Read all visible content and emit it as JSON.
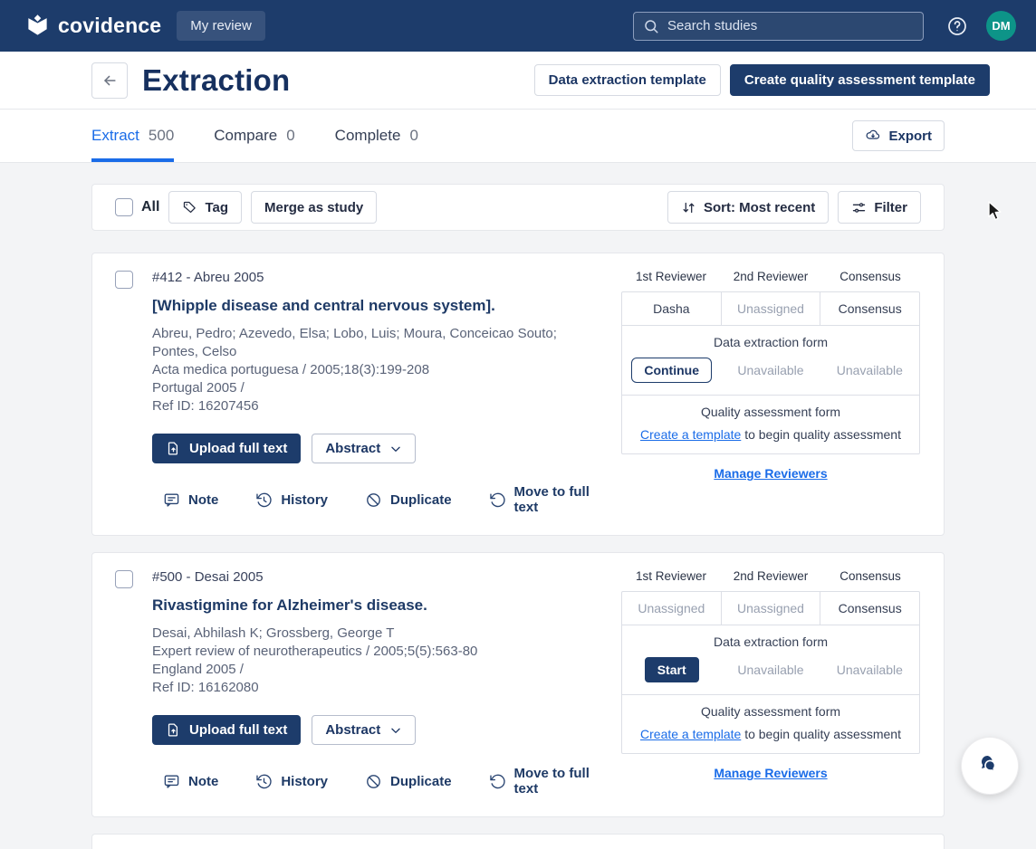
{
  "colors": {
    "header_bg": "#1d3c6b",
    "brand_navy": "#1d3c6b",
    "accent_blue": "#1a6ce8",
    "avatar_teal": "#0d9488",
    "page_bg": "#f3f4f6",
    "border": "#e5e7eb"
  },
  "header": {
    "brand": "covidence",
    "my_review": "My review",
    "search_placeholder": "Search studies",
    "avatar": "DM"
  },
  "title_bar": {
    "title": "Extraction",
    "secondary_button": "Data extraction template",
    "primary_button": "Create quality assessment template"
  },
  "tabs": [
    {
      "label": "Extract",
      "count": "500"
    },
    {
      "label": "Compare",
      "count": "0"
    },
    {
      "label": "Complete",
      "count": "0"
    }
  ],
  "export_button": "Export",
  "toolbar": {
    "all": "All",
    "tag": "Tag",
    "merge": "Merge as study",
    "sort": "Sort: Most recent",
    "filter": "Filter"
  },
  "reviewer_table": {
    "headers": [
      "1st Reviewer",
      "2nd Reviewer",
      "Consensus"
    ],
    "extraction_title": "Data extraction form",
    "quality_title": "Quality assessment form",
    "quality_link": "Create a template",
    "quality_rest": " to begin quality assessment",
    "manage": "Manage Reviewers"
  },
  "studies": [
    {
      "ref": "#412 - Abreu 2005",
      "title": "[Whipple disease and central nervous system].",
      "authors": "Abreu, Pedro; Azevedo, Elsa; Lobo, Luis; Moura, Conceicao Souto; Pontes, Celso",
      "source": "Acta medica portuguesa / 2005;18(3):199-208",
      "location": "Portugal 2005 /",
      "ref_id": "Ref ID: 16207456",
      "upload": "Upload full text",
      "abstract": "Abstract",
      "actions": [
        "Note",
        "History",
        "Duplicate",
        "Move to full text"
      ],
      "reviewers": [
        "Dasha",
        "Unassigned",
        "Consensus"
      ],
      "extraction_action": "Continue",
      "extraction_cells": [
        "Unavailable",
        "Unavailable"
      ]
    },
    {
      "ref": "#500 - Desai 2005",
      "title": "Rivastigmine for Alzheimer's disease.",
      "authors": "Desai, Abhilash K; Grossberg, George T",
      "source": "Expert review of neurotherapeutics / 2005;5(5):563-80",
      "location": "England 2005 /",
      "ref_id": "Ref ID: 16162080",
      "upload": "Upload full text",
      "abstract": "Abstract",
      "actions": [
        "Note",
        "History",
        "Duplicate",
        "Move to full text"
      ],
      "reviewers": [
        "Unassigned",
        "Unassigned",
        "Consensus"
      ],
      "extraction_action": "Start",
      "extraction_cells": [
        "Unavailable",
        "Unavailable"
      ]
    }
  ]
}
